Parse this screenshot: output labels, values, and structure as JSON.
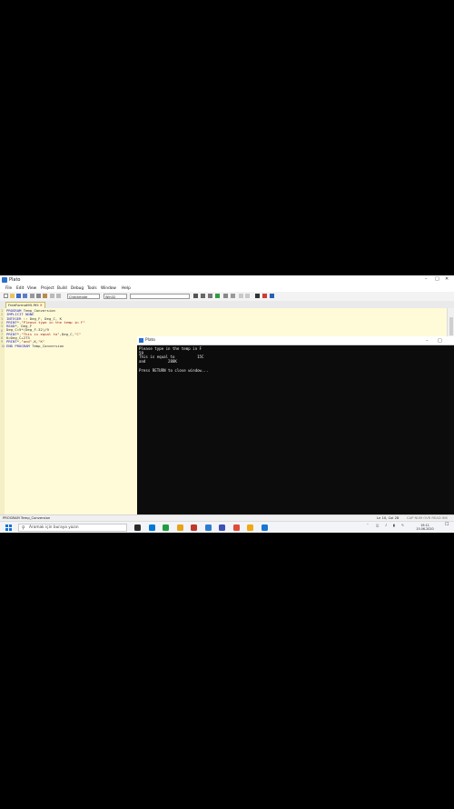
{
  "window": {
    "title": "Plato"
  },
  "menu": [
    "File",
    "Edit",
    "View",
    "Project",
    "Build",
    "Debug",
    "Tools",
    "Window",
    "Help"
  ],
  "toolbar": {
    "build_config": "Checkmate",
    "platform": "Win32",
    "search_value": ""
  },
  "editor": {
    "tab_label": "FreeFormat95.f95",
    "lines": [
      [
        {
          "t": "PROGRAM",
          "c": "kw"
        },
        {
          "t": " Temp_Conversion",
          "c": ""
        }
      ],
      [
        {
          "t": "IMPLICIT NONE",
          "c": "kw"
        }
      ],
      [
        {
          "t": "INTEGER",
          "c": "kw"
        },
        {
          "t": " :: Deg_F, Deg_C, K",
          "c": ""
        }
      ],
      [
        {
          "t": "PRINT",
          "c": "kw"
        },
        {
          "t": "*,",
          "c": ""
        },
        {
          "t": "\"Please type in the temp in F\"",
          "c": "str"
        }
      ],
      [
        {
          "t": "READ",
          "c": "kw"
        },
        {
          "t": "*, Deg_F",
          "c": ""
        }
      ],
      [
        {
          "t": "Deg_C=5*(Deg_F-32)/9",
          "c": ""
        }
      ],
      [
        {
          "t": "PRINT",
          "c": "kw"
        },
        {
          "t": "*,",
          "c": ""
        },
        {
          "t": "\"This is equal to\"",
          "c": "str"
        },
        {
          "t": ",Deg_C,",
          "c": ""
        },
        {
          "t": "\"C\"",
          "c": "str"
        }
      ],
      [
        {
          "t": "K=Deg_C+273",
          "c": ""
        }
      ],
      [
        {
          "t": "PRINT",
          "c": "kw"
        },
        {
          "t": "*,",
          "c": ""
        },
        {
          "t": "\"and\"",
          "c": "str"
        },
        {
          "t": ",K,",
          "c": ""
        },
        {
          "t": "\"K\"",
          "c": "str"
        }
      ],
      [
        {
          "t": "END PROGRAM",
          "c": "kw"
        },
        {
          "t": " Temp_Conversion",
          "c": ""
        }
      ]
    ]
  },
  "console": {
    "title": "Plato",
    "output": "Please type in the temp in F\n59\nThis is equal to          15C\nand          288K\n\nPress RETURN to close window..."
  },
  "status": {
    "left": "PROGRAM Temp_Conversion",
    "position": "Ln 10, Col 28",
    "indicators": "CAP NUM OVR READ INS"
  },
  "taskbar": {
    "search_placeholder": "Aramak için buraya yazın",
    "time": "19:11",
    "date": "15.06.2020",
    "icon_colors": [
      "#2b2b2b",
      "#0078d7",
      "#1e9e3e",
      "#e8a21a",
      "#c0392b",
      "#2a7dd1",
      "#3f51b5",
      "#e04b3a",
      "#f3a712",
      "#1976d2"
    ]
  },
  "colors": {
    "editor_bg": "#fffbd9",
    "console_bg": "#0c0c0c",
    "accent": "#1672d6"
  }
}
